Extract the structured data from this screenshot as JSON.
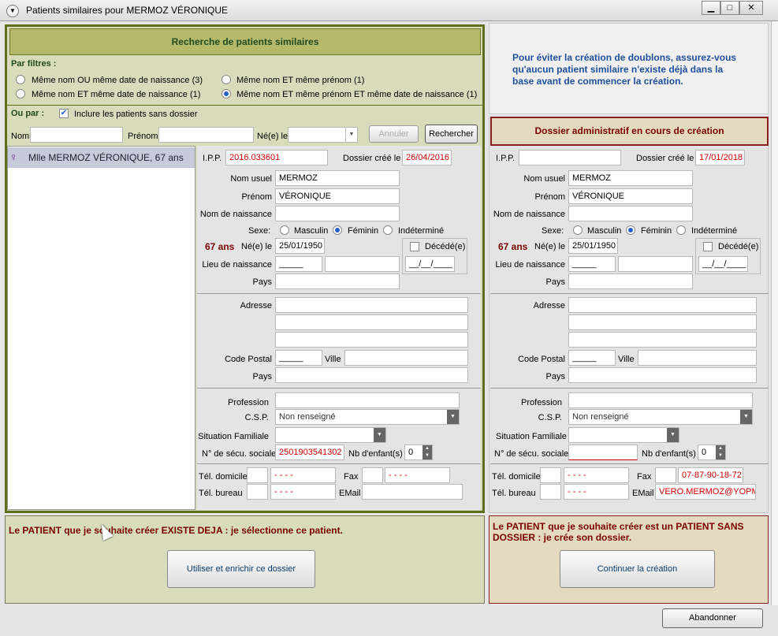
{
  "window": {
    "title": "Patients similaires pour MERMOZ VÉRONIQUE"
  },
  "left": {
    "header": "Recherche de patients similaires",
    "filters_label": "Par filtres :",
    "filters": [
      {
        "label": "Même nom OU même date de naissance (3)",
        "selected": false
      },
      {
        "label": "Même nom ET même prénom (1)",
        "selected": false
      },
      {
        "label": "Même nom ET même date de naissance (1)",
        "selected": false
      },
      {
        "label": "Même nom ET même prénom ET même date de naissance (1)",
        "selected": true
      }
    ],
    "or_label": "Ou par :",
    "include_label": "Inclure les patients sans dossier",
    "search": {
      "nom_label": "Nom",
      "prenom_label": "Prénom",
      "ne_label": "Né(e) le",
      "annuler": "Annuler",
      "rechercher": "Rechercher"
    },
    "result_item": "Mlle MERMOZ VÉRONIQUE, 67 ans",
    "form": {
      "ipp_label": "I.P.P.",
      "ipp": "2016.033601",
      "dossier_label": "Dossier créé le",
      "dossier": "26/04/2016",
      "nom_usuel_label": "Nom usuel",
      "nom_usuel": "MERMOZ",
      "prenom_label": "Prénom",
      "prenom": "VÉRONIQUE",
      "nom_naissance_label": "Nom de naissance",
      "nom_naissance": "",
      "sexe_label": "Sexe:",
      "masculin": "Masculin",
      "feminin": "Féminin",
      "indetermine": "Indéterminé",
      "age": "67 ans",
      "ne_label": "Né(e) le",
      "ne": "25/01/1950",
      "decede_label": "Décédé(e)",
      "decede_date": "__/__/____",
      "lieu_label": "Lieu de naissance",
      "lieu_cp": "_____",
      "pays_label": "Pays",
      "adresse_label": "Adresse",
      "cp_label": "Code Postal",
      "cp": "_____",
      "ville_label": "Ville",
      "pays2_label": "Pays",
      "profession_label": "Profession",
      "csp_label": "C.S.P.",
      "csp": "Non renseigné",
      "situation_label": "Situation Familiale",
      "secu_label": "N° de sécu. sociale",
      "secu": "2501903541302",
      "enfants_label": "Nb d'enfant(s)",
      "enfants": "0",
      "tel_dom_label": "Tél. domicile",
      "tel_dom": "- - - -",
      "fax_label": "Fax",
      "fax": "- - - -",
      "tel_bur_label": "Tél. bureau",
      "tel_bur": "- - - -",
      "email_label": "EMail",
      "email": ""
    },
    "action_text": "Le PATIENT que je souhaite créer EXISTE DEJA : je sélectionne ce patient.",
    "action_button": "Utiliser et enrichir ce dossier"
  },
  "right": {
    "info": "Pour éviter la création de doublons, assurez-vous qu'aucun patient similaire n'existe déjà dans la base avant de commencer la création.",
    "header": "Dossier administratif en cours de création",
    "form": {
      "ipp_label": "I.P.P.",
      "ipp": "",
      "dossier_label": "Dossier créé le",
      "dossier": "17/01/2018",
      "nom_usuel_label": "Nom usuel",
      "nom_usuel": "MERMOZ",
      "prenom_label": "Prénom",
      "prenom": "VÉRONIQUE",
      "nom_naissance_label": "Nom de naissance",
      "nom_naissance": "",
      "sexe_label": "Sexe:",
      "masculin": "Masculin",
      "feminin": "Féminin",
      "indetermine": "Indéterminé",
      "age": "67 ans",
      "ne_label": "Né(e) le",
      "ne": "25/01/1950",
      "decede_label": "Décédé(e)",
      "decede_date": "__/__/____",
      "lieu_label": "Lieu de naissance",
      "lieu_cp": "_____",
      "pays_label": "Pays",
      "adresse_label": "Adresse",
      "cp_label": "Code Postal",
      "cp": "_____",
      "ville_label": "Ville",
      "pays2_label": "Pays",
      "profession_label": "Profession",
      "csp_label": "C.S.P.",
      "csp": "Non renseigné",
      "situation_label": "Situation Familiale",
      "secu_label": "N° de sécu. sociale",
      "secu": "",
      "enfants_label": "Nb d'enfant(s)",
      "enfants": "0",
      "tel_dom_label": "Tél. domicile",
      "tel_dom": "- - - -",
      "fax_label": "Fax",
      "fax": "07-87-90-18-72",
      "tel_bur_label": "Tél. bureau",
      "tel_bur": "- - - -",
      "email_label": "EMail",
      "email": "VERO.MERMOZ@YOPMA"
    },
    "action_text": "Le PATIENT que je souhaite créer est un PATIENT SANS DOSSIER : je crée son dossier.",
    "action_button": "Continuer la création"
  },
  "footer": {
    "abandon": "Abandonner"
  },
  "colors": {
    "green_panel": "#d9dcbb",
    "green_border": "#5f6d1e",
    "tan_panel": "#e4dac0",
    "tan_border": "#8a1f1f",
    "red_text": "#7a0000",
    "blue_text": "#1f4f9c"
  }
}
